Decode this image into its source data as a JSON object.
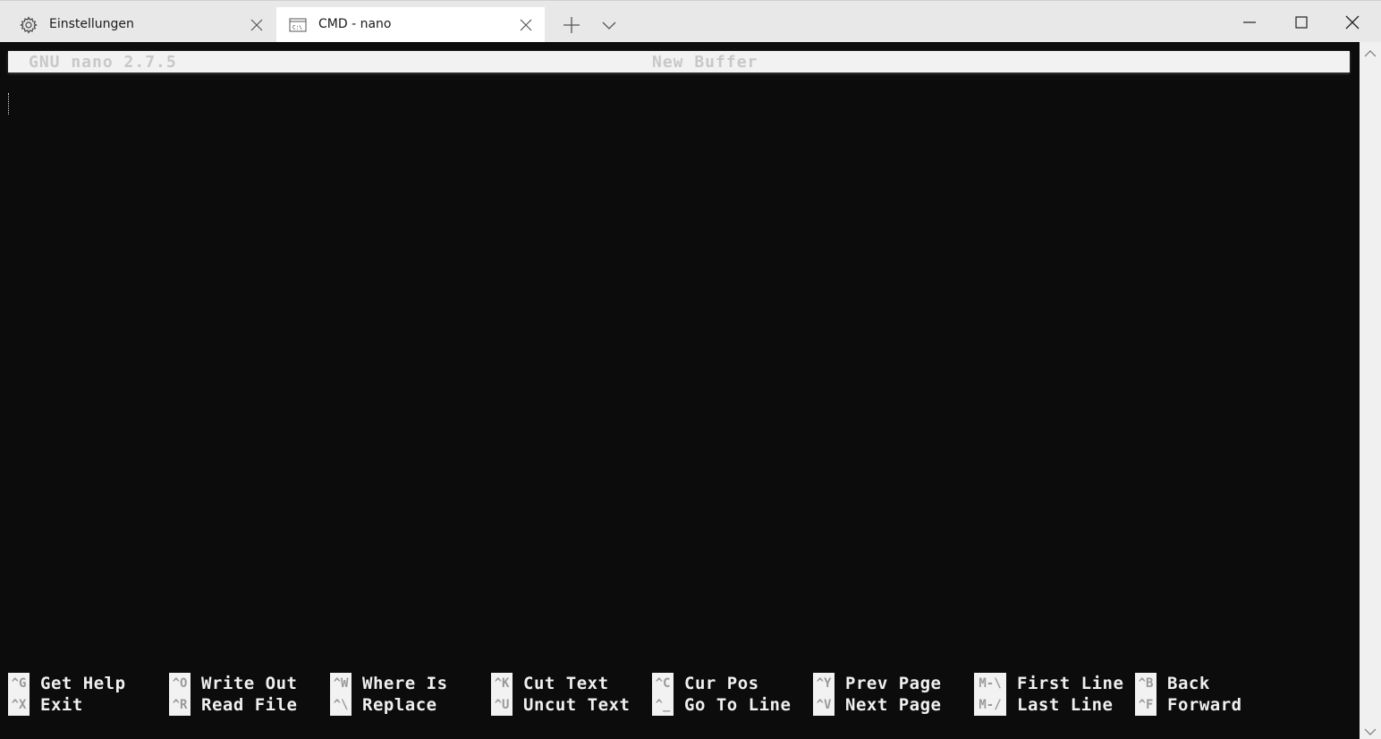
{
  "tabs": [
    {
      "label": "Einstellungen",
      "icon": "gear-icon",
      "active": false
    },
    {
      "label": "CMD - nano",
      "icon": "cmd-icon",
      "active": true
    }
  ],
  "nano": {
    "version": "GNU nano 2.7.5",
    "buffer": "New Buffer",
    "shortcuts": [
      {
        "key1": "^G",
        "label1": "Get Help",
        "key2": "^X",
        "label2": "Exit"
      },
      {
        "key1": "^O",
        "label1": "Write Out",
        "key2": "^R",
        "label2": "Read File"
      },
      {
        "key1": "^W",
        "label1": "Where Is",
        "key2": "^\\",
        "label2": "Replace"
      },
      {
        "key1": "^K",
        "label1": "Cut Text",
        "key2": "^U",
        "label2": "Uncut Text"
      },
      {
        "key1": "^C",
        "label1": "Cur Pos",
        "key2": "^_",
        "label2": "Go To Line"
      },
      {
        "key1": "^Y",
        "label1": "Prev Page",
        "key2": "^V",
        "label2": "Next Page"
      },
      {
        "key1": "M-\\",
        "label1": "First Line",
        "key2": "M-/",
        "label2": "Last Line"
      },
      {
        "key1": "^B",
        "label1": "Back",
        "key2": "^F",
        "label2": "Forward"
      }
    ]
  },
  "colors": {
    "terminal_bg": "#0c0c0c",
    "titlebar_bg": "#e8e8e8",
    "active_tab_bg": "#ffffff",
    "inverse_bg": "#f2f2f2"
  }
}
